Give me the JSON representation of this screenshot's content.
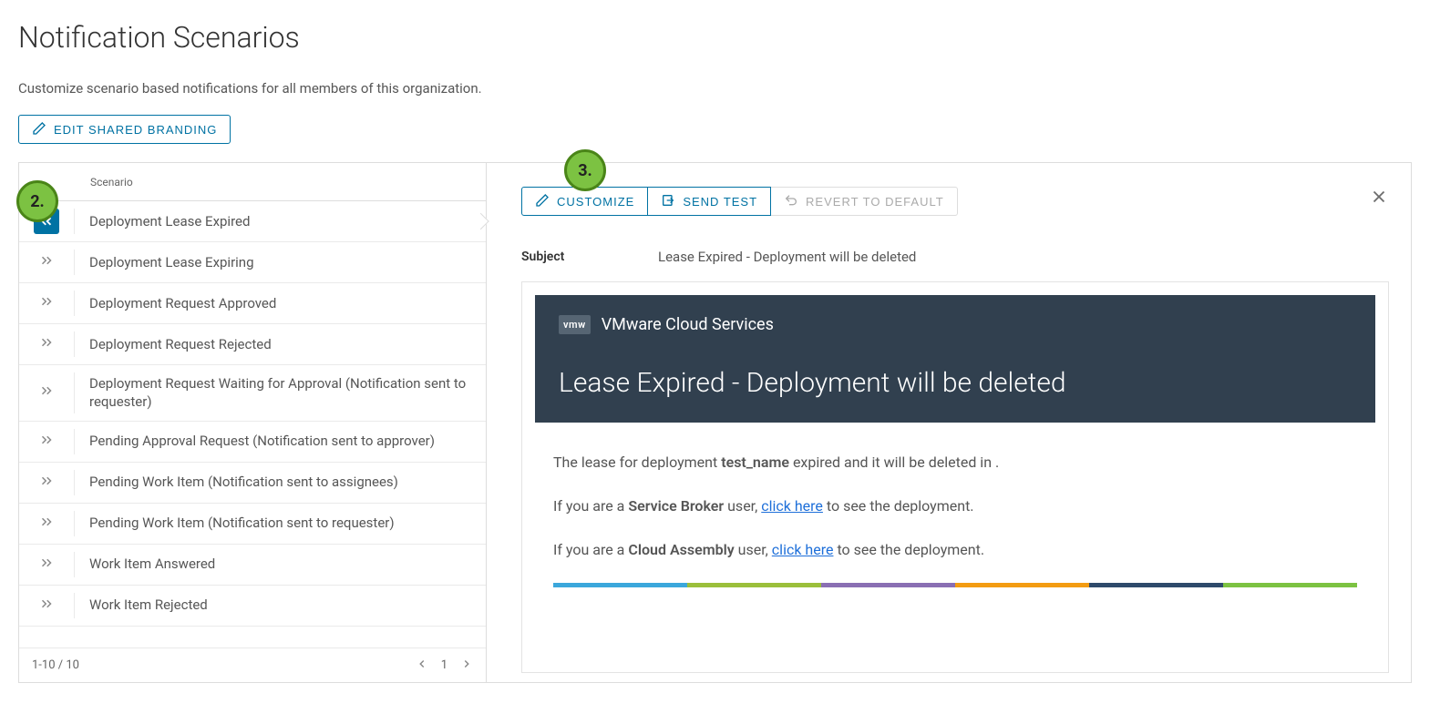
{
  "page": {
    "title": "Notification Scenarios",
    "subtitle": "Customize scenario based notifications for all members of this organization."
  },
  "toolbar": {
    "editBranding": "Edit Shared Branding"
  },
  "callouts": {
    "a": "2.",
    "b": "3."
  },
  "table": {
    "header": "Scenario",
    "rows": [
      {
        "label": "Deployment Lease Expired",
        "selected": true
      },
      {
        "label": "Deployment Lease Expiring"
      },
      {
        "label": "Deployment Request Approved"
      },
      {
        "label": "Deployment Request Rejected"
      },
      {
        "label": "Deployment Request Waiting for Approval (Notification sent to requester)"
      },
      {
        "label": "Pending Approval Request (Notification sent to approver)"
      },
      {
        "label": "Pending Work Item (Notification sent to assignees)"
      },
      {
        "label": "Pending Work Item (Notification sent to requester)"
      },
      {
        "label": "Work Item Answered"
      },
      {
        "label": "Work Item Rejected"
      }
    ],
    "pager": {
      "range": "1-10 / 10",
      "page": "1"
    }
  },
  "detail": {
    "actions": {
      "customize": "Customize",
      "sendTest": "Send Test",
      "revert": "Revert to Default"
    },
    "subjectLabel": "Subject",
    "subjectValue": "Lease Expired - Deployment will be deleted",
    "email": {
      "brandLogoText": "vmw",
      "brandName": "VMware Cloud Services",
      "title": "Lease Expired - Deployment will be deleted",
      "body": {
        "p1a": "The lease for deployment ",
        "p1b": "test_name",
        "p1c": " expired and it will be deleted in .",
        "p2a": "If you are a ",
        "p2b": "Service Broker",
        "p2c": " user, ",
        "p2link": "click here",
        "p2d": " to see the deployment.",
        "p3a": "If you are a ",
        "p3b": "Cloud Assembly",
        "p3c": " user, ",
        "p3link": "click here",
        "p3d": " to see the deployment."
      },
      "stripeColors": [
        "#3ba7db",
        "#9bbf3b",
        "#8a6fb3",
        "#f39c12",
        "#2e4a6b",
        "#7CC242"
      ]
    }
  }
}
